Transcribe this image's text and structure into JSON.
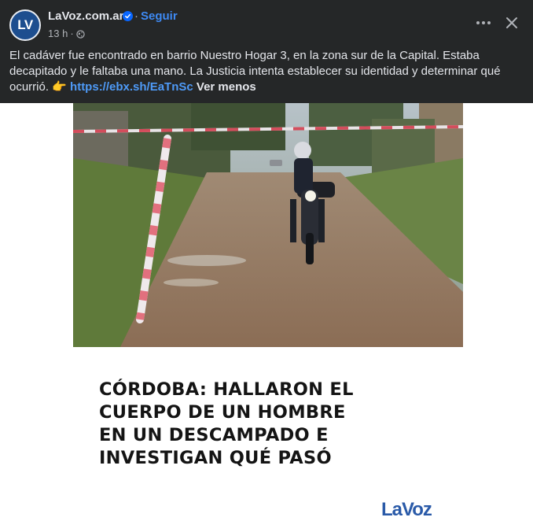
{
  "header": {
    "avatar_initials": "LV",
    "page_name": "LaVoz.com.ar",
    "separator": "·",
    "follow_label": "Seguir",
    "time": "13 h",
    "time_sep": "·"
  },
  "post": {
    "text": "El cadáver fue encontrado en barrio Nuestro Hogar 3, en la zona sur de la Capital. Estaba decapitado y le faltaba una mano. La Justicia intenta establecer su identidad y determinar qué ocurrió. 👉 ",
    "link": "https://ebx.sh/EaTnSc",
    "see_less": "Ver menos"
  },
  "card": {
    "headline_lines": [
      "CÓRDOBA: HALLARON EL",
      "CUERPO DE UN HOMBRE",
      "EN UN DESCAMPADO E",
      "INVESTIGAN QUÉ PASÓ"
    ],
    "brand": "LaVoz"
  },
  "icons": {
    "verified": "verified-badge-icon",
    "audience": "globe-icon",
    "more": "more-options-icon",
    "close": "close-icon"
  },
  "colors": {
    "background": "#252728",
    "link": "#4e9af7",
    "brand": "#2a5aa8",
    "verified": "#0866ff"
  }
}
